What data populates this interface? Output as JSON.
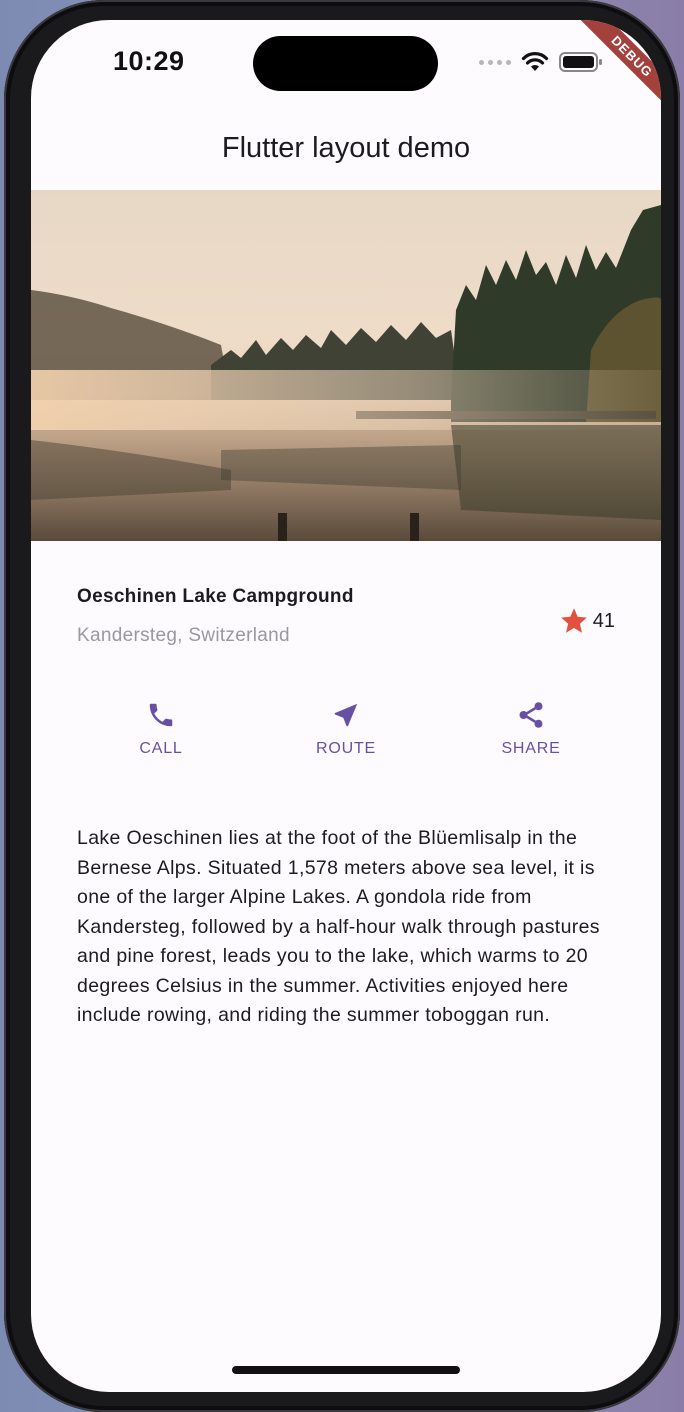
{
  "status_bar": {
    "time": "10:29",
    "icons": [
      "signal-dots-icon",
      "wifi-icon",
      "battery-icon"
    ],
    "debug_banner": "DEBUG"
  },
  "app_bar": {
    "title": "Flutter layout demo"
  },
  "hero_image": {
    "subject": "misty lake with forest at sunrise"
  },
  "title_section": {
    "name": "Oeschinen Lake Campground",
    "location": "Kandersteg, Switzerland",
    "rating_icon": "star-icon",
    "rating_count": "41"
  },
  "actions": [
    {
      "label": "CALL",
      "icon": "phone-icon"
    },
    {
      "label": "ROUTE",
      "icon": "navigation-icon"
    },
    {
      "label": "SHARE",
      "icon": "share-icon"
    }
  ],
  "description": "Lake Oeschinen lies at the foot of the Blüemlisalp in the Bernese Alps. Situated 1,578 meters above sea level, it is one of the larger Alpine Lakes. A gondola ride from Kandersteg, followed by a half-hour walk through pastures and pine forest, leads you to the lake, which warms to 20 degrees Celsius in the summer. Activities enjoyed here include rowing, and riding the summer toboggan run.",
  "colors": {
    "accent": "#6750a4",
    "star": "#e4503f",
    "surface": "#fefbff",
    "secondary_text": "#9a979d",
    "debug_banner": "#a4413d"
  }
}
